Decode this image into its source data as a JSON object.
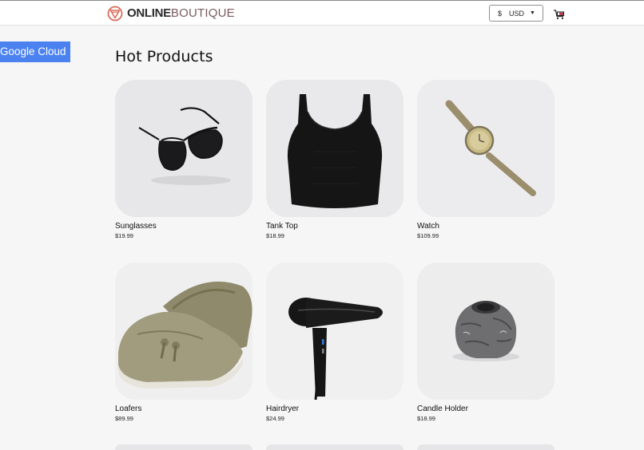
{
  "header": {
    "logo_bold": "ONLINE",
    "logo_thin": "BOUTIQUE",
    "currency_symbol": "$",
    "currency_code": "USD"
  },
  "badge": {
    "label": "Google Cloud"
  },
  "main": {
    "title": "Hot Products",
    "products": [
      {
        "name": "Sunglasses",
        "price": "$19.99",
        "icon": "sunglasses"
      },
      {
        "name": "Tank Top",
        "price": "$18.99",
        "icon": "tank-top"
      },
      {
        "name": "Watch",
        "price": "$109.99",
        "icon": "watch"
      },
      {
        "name": "Loafers",
        "price": "$89.99",
        "icon": "loafers"
      },
      {
        "name": "Hairdryer",
        "price": "$24.99",
        "icon": "hairdryer"
      },
      {
        "name": "Candle Holder",
        "price": "$18.99",
        "icon": "candle-holder"
      }
    ]
  },
  "colors": {
    "accent": "#4b82f0",
    "logo_mark": "#d96b5a",
    "background": "#f6f6f6",
    "card_bg": "#e6e6e8"
  }
}
